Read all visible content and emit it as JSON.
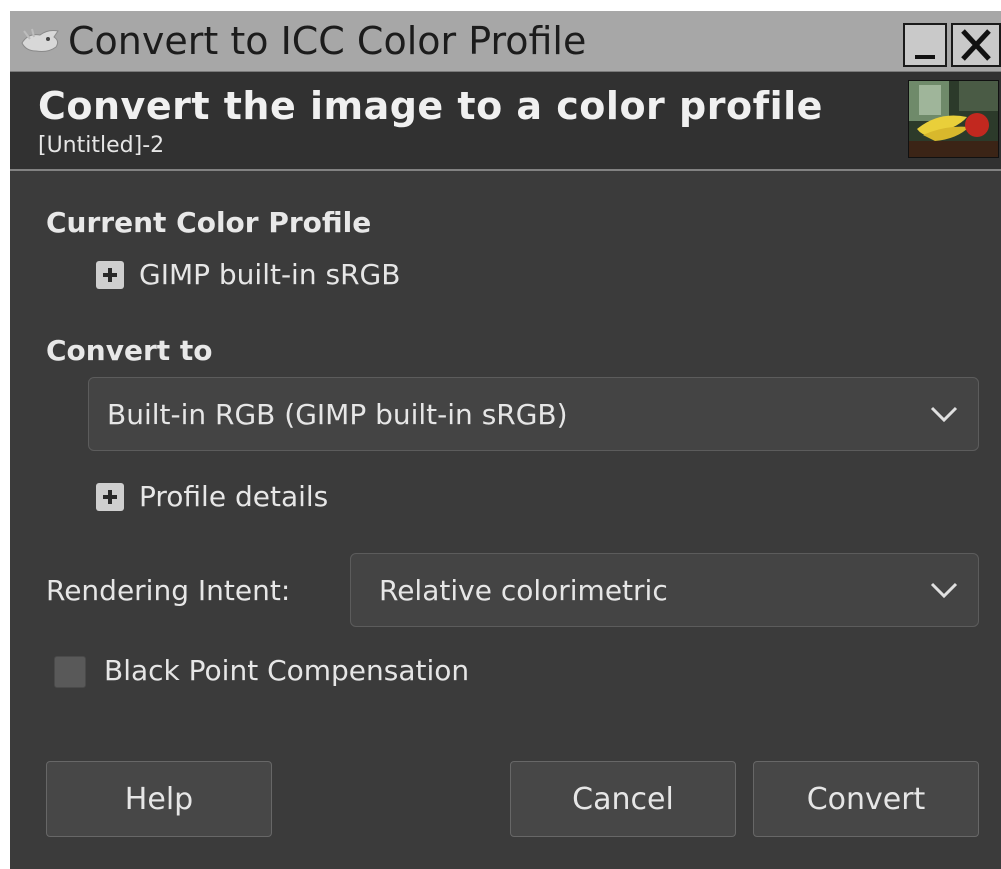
{
  "window": {
    "title": "Convert to ICC Color Profile",
    "minimize_label": "_",
    "close_label": "X"
  },
  "header": {
    "title": "Convert the image to a color profile",
    "subtitle": "[Untitled]-2"
  },
  "current_profile": {
    "section_label": "Current Color Profile",
    "profile_name": "GIMP built-in sRGB"
  },
  "convert_to": {
    "section_label": "Convert to",
    "selected_profile": "Built-in RGB (GIMP built-in sRGB)",
    "details_label": "Profile details"
  },
  "rendering_intent": {
    "label": "Rendering Intent:",
    "selected": "Relative colorimetric"
  },
  "black_point": {
    "label": "Black Point Compensation",
    "checked": false
  },
  "buttons": {
    "help": "Help",
    "cancel": "Cancel",
    "convert": "Convert"
  },
  "icons": {
    "app": "gimp-wilber-icon",
    "thumbnail": "image-thumbnail",
    "expander": "plus-expander-icon",
    "dropdown": "chevron-down-icon"
  },
  "colors": {
    "window_bg": "#3b3b3b",
    "titlebar_bg": "#a7a7a7",
    "header_bg": "#313131",
    "text": "#e6e6e6"
  }
}
